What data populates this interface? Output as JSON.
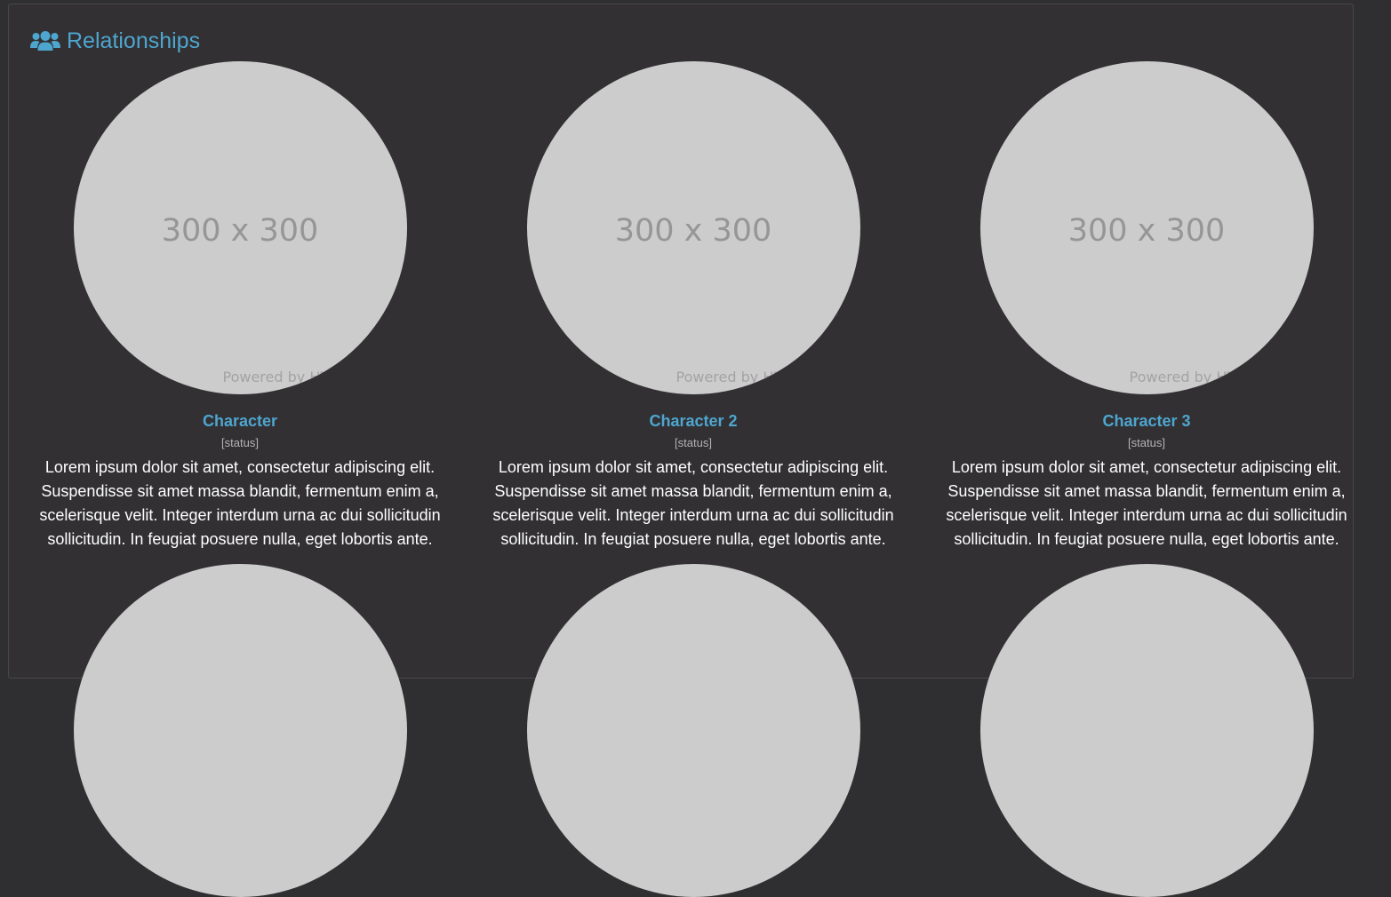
{
  "section": {
    "title": "Relationships",
    "icon": "users-icon",
    "accent_color": "#4ea6cf"
  },
  "placeholder_image": {
    "size_text": "300 x 300",
    "powered_text": "Powered by HTML.COM"
  },
  "characters": [
    {
      "name": "Character",
      "status": "[status]",
      "description": "Lorem ipsum dolor sit amet, consectetur adipiscing elit. Suspendisse sit amet massa blandit, fermentum enim a, scelerisque velit. Integer interdum urna ac dui sollicitudin sollicitudin. In feugiat posuere nulla, eget lobortis ante."
    },
    {
      "name": "Character 2",
      "status": "[status]",
      "description": "Lorem ipsum dolor sit amet, consectetur adipiscing elit. Suspendisse sit amet massa blandit, fermentum enim a, scelerisque velit. Integer interdum urna ac dui sollicitudin sollicitudin. In feugiat posuere nulla, eget lobortis ante."
    },
    {
      "name": "Character 3",
      "status": "[status]",
      "description": "Lorem ipsum dolor sit amet, consectetur adipiscing elit. Suspendisse sit amet massa blandit, fermentum enim a, scelerisque velit. Integer interdum urna ac dui sollicitudin sollicitudin. In feugiat posuere nulla, eget lobortis ante."
    }
  ]
}
